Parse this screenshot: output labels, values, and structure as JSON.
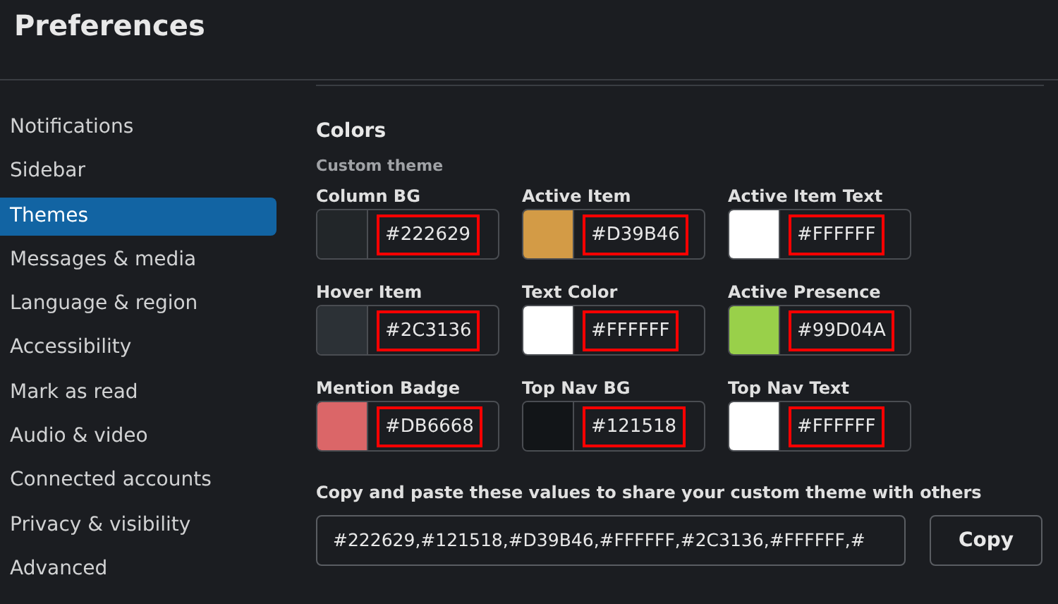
{
  "title": "Preferences",
  "sidebar": {
    "items": [
      {
        "label": "Notifications",
        "selected": false
      },
      {
        "label": "Sidebar",
        "selected": false
      },
      {
        "label": "Themes",
        "selected": true
      },
      {
        "label": "Messages & media",
        "selected": false
      },
      {
        "label": "Language & region",
        "selected": false
      },
      {
        "label": "Accessibility",
        "selected": false
      },
      {
        "label": "Mark as read",
        "selected": false
      },
      {
        "label": "Audio & video",
        "selected": false
      },
      {
        "label": "Connected accounts",
        "selected": false
      },
      {
        "label": "Privacy & visibility",
        "selected": false
      },
      {
        "label": "Advanced",
        "selected": false
      }
    ]
  },
  "section": {
    "title": "Colors",
    "subtitle": "Custom theme"
  },
  "colors": [
    {
      "label": "Column BG",
      "value": "#222629",
      "color": "#222629",
      "highlighted": true
    },
    {
      "label": "Active Item",
      "value": "#D39B46",
      "color": "#d39b46",
      "highlighted": true
    },
    {
      "label": "Active Item Text",
      "value": "#FFFFFF",
      "color": "#ffffff",
      "highlighted": true
    },
    {
      "label": "Hover Item",
      "value": "#2C3136",
      "color": "#2c3136",
      "highlighted": true
    },
    {
      "label": "Text Color",
      "value": "#FFFFFF",
      "color": "#ffffff",
      "highlighted": true
    },
    {
      "label": "Active Presence",
      "value": "#99D04A",
      "color": "#99d04a",
      "highlighted": true
    },
    {
      "label": "Mention Badge",
      "value": "#DB6668",
      "color": "#db6668",
      "highlighted": true
    },
    {
      "label": "Top Nav BG",
      "value": "#121518",
      "color": "#121518",
      "highlighted": true
    },
    {
      "label": "Top Nav Text",
      "value": "#FFFFFF",
      "color": "#ffffff",
      "highlighted": true
    }
  ],
  "share": {
    "label": "Copy and paste these values to share your custom theme with others",
    "value": "#222629,#121518,#D39B46,#FFFFFF,#2C3136,#FFFFFF,#",
    "button": "Copy"
  }
}
